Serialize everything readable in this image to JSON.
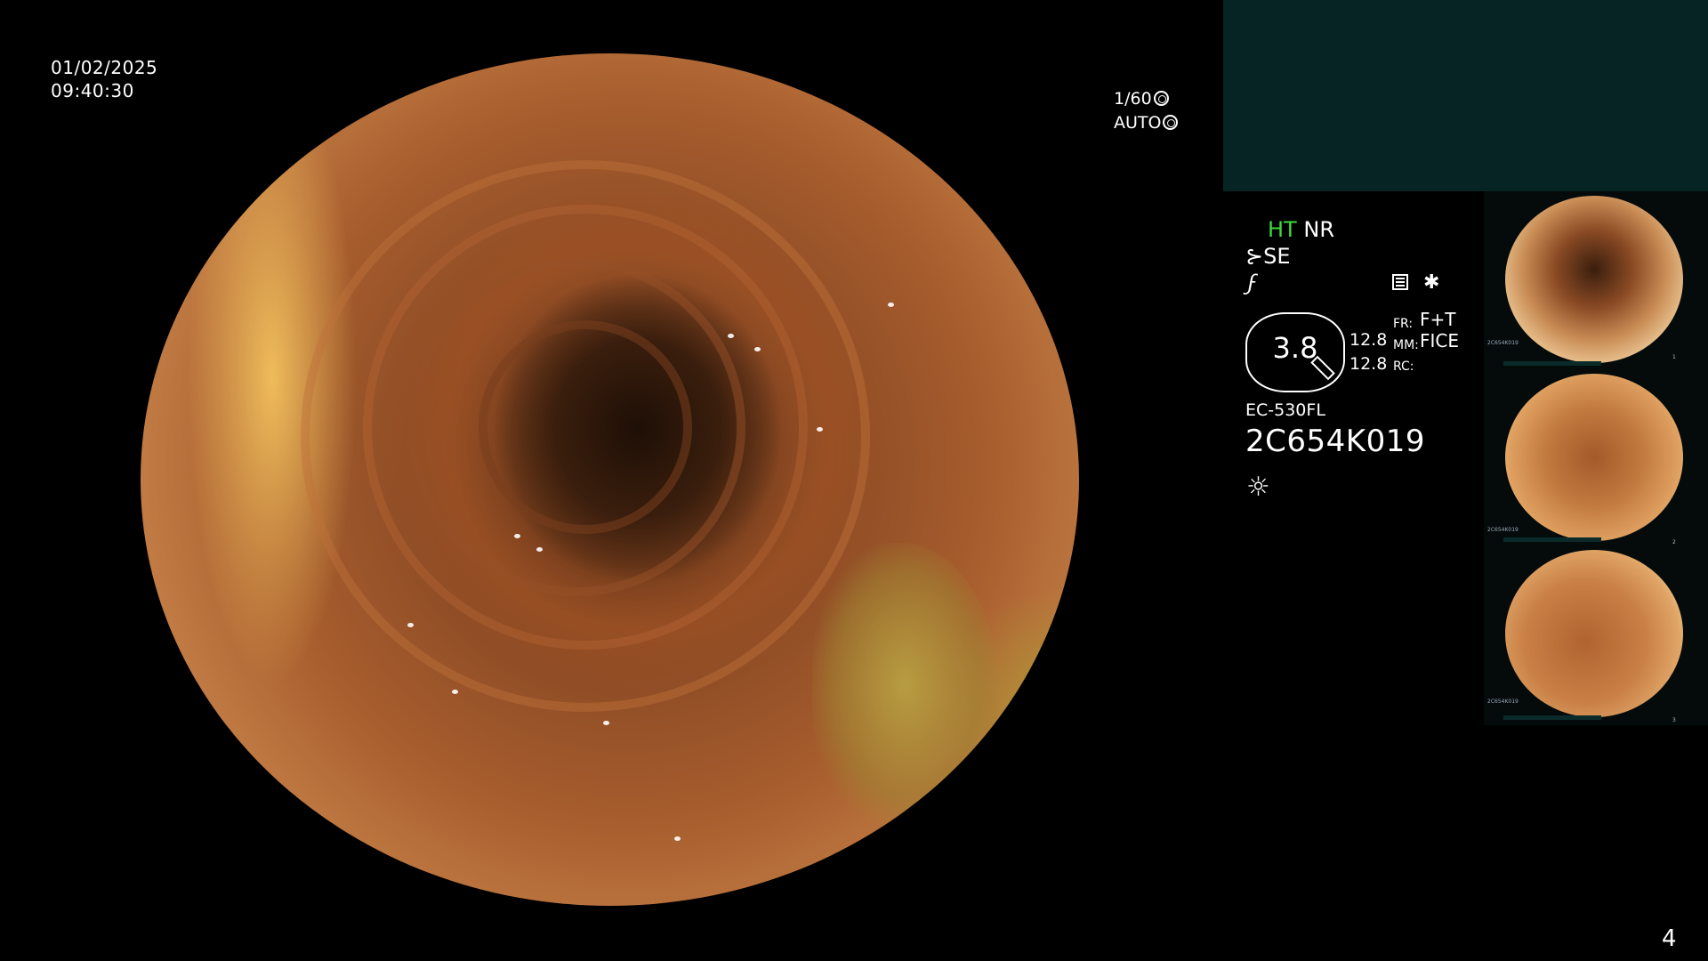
{
  "overlay": {
    "date": "01/02/2025",
    "time": "09:40:30",
    "shutter": "1/60",
    "iris_mode": "AUTO"
  },
  "settings": {
    "ht": "HT",
    "nr": "NR",
    "se": "SE",
    "zoom_value": "3.8",
    "num1": "12.8",
    "num2": "12.8",
    "fr_label": "FR:",
    "fr_value": "F+T",
    "mm_label": "MM:",
    "mm_value": "FICE",
    "rc_label": "RC:",
    "rc_value": ""
  },
  "scope": {
    "model": "EC-530FL",
    "serial": "2C654K019"
  },
  "thumbnails": [
    {
      "caption": "2C654K019",
      "index": "1"
    },
    {
      "caption": "2C654K019",
      "index": "2"
    },
    {
      "caption": "2C654K019",
      "index": "3"
    }
  ],
  "page_number": "4",
  "colors": {
    "background": "#000000",
    "panel_box": "#072424",
    "ht_green": "#3ddc3d"
  },
  "icons": [
    "aperture-icon",
    "iris-icon",
    "scope-mode-icon",
    "freeze-icon",
    "menu-icon",
    "star-icon",
    "light-icon"
  ]
}
